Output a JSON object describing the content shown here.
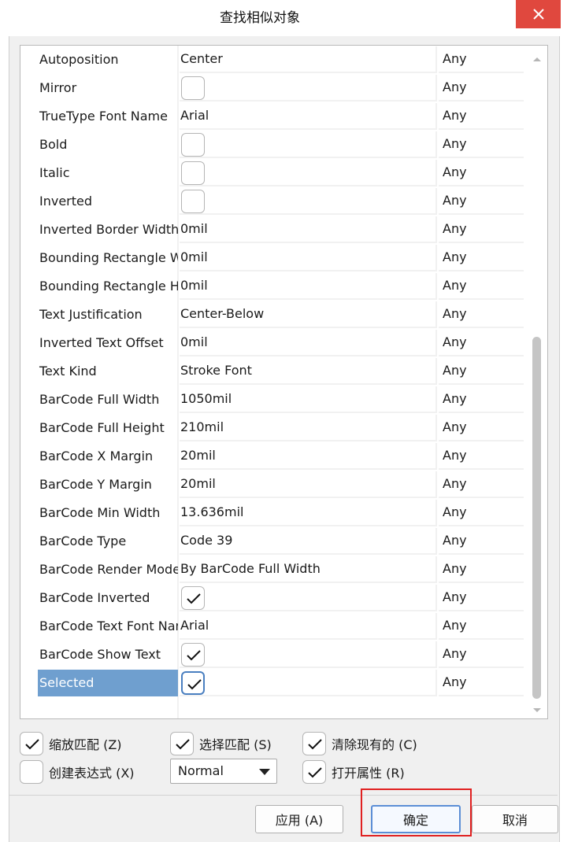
{
  "window": {
    "title": "查找相似对象",
    "close_glyph": "✕"
  },
  "rows": [
    {
      "name": "Autoposition",
      "type": "text",
      "value": "Center",
      "match": "Any"
    },
    {
      "name": "Mirror",
      "type": "check",
      "checked": false,
      "match": "Any"
    },
    {
      "name": "TrueType Font Name",
      "type": "text",
      "value": "Arial",
      "match": "Any"
    },
    {
      "name": "Bold",
      "type": "check",
      "checked": false,
      "match": "Any"
    },
    {
      "name": "Italic",
      "type": "check",
      "checked": false,
      "match": "Any"
    },
    {
      "name": "Inverted",
      "type": "check",
      "checked": false,
      "match": "Any"
    },
    {
      "name": "Inverted Border Width",
      "type": "text",
      "value": "0mil",
      "match": "Any"
    },
    {
      "name": "Bounding Rectangle Width",
      "type": "text",
      "value": "0mil",
      "match": "Any"
    },
    {
      "name": "Bounding Rectangle Height",
      "type": "text",
      "value": "0mil",
      "match": "Any"
    },
    {
      "name": "Text Justification",
      "type": "text",
      "value": "Center-Below",
      "match": "Any"
    },
    {
      "name": "Inverted Text Offset",
      "type": "text",
      "value": "0mil",
      "match": "Any"
    },
    {
      "name": "Text Kind",
      "type": "text",
      "value": "Stroke Font",
      "match": "Any"
    },
    {
      "name": "BarCode Full Width",
      "type": "text",
      "value": "1050mil",
      "match": "Any"
    },
    {
      "name": "BarCode Full Height",
      "type": "text",
      "value": "210mil",
      "match": "Any"
    },
    {
      "name": "BarCode X Margin",
      "type": "text",
      "value": "20mil",
      "match": "Any"
    },
    {
      "name": "BarCode Y Margin",
      "type": "text",
      "value": "20mil",
      "match": "Any"
    },
    {
      "name": "BarCode Min Width",
      "type": "text",
      "value": "13.636mil",
      "match": "Any"
    },
    {
      "name": "BarCode Type",
      "type": "text",
      "value": "Code 39",
      "match": "Any"
    },
    {
      "name": "BarCode Render Mode",
      "type": "text",
      "value": "By BarCode Full Width",
      "match": "Any"
    },
    {
      "name": "BarCode Inverted",
      "type": "check",
      "checked": true,
      "match": "Any"
    },
    {
      "name": "BarCode Text Font Name",
      "type": "text",
      "value": "Arial",
      "match": "Any"
    },
    {
      "name": "BarCode Show Text",
      "type": "check",
      "checked": true,
      "match": "Any"
    },
    {
      "name": "Selected",
      "type": "check",
      "checked": true,
      "match": "Any",
      "selected": true
    }
  ],
  "options": {
    "zoom_match": {
      "label": "缩放匹配 (Z)",
      "checked": true
    },
    "select_match": {
      "label": "选择匹配 (S)",
      "checked": true
    },
    "clear_existing": {
      "label": "清除现有的 (C)",
      "checked": true
    },
    "create_expression": {
      "label": "创建表达式 (X)",
      "checked": false
    },
    "open_inspector": {
      "label": "打开属性 (R)",
      "checked": true
    },
    "mode_select": {
      "value": "Normal"
    }
  },
  "buttons": {
    "apply": "应用 (A)",
    "ok": "确定",
    "cancel": "取消"
  },
  "colors": {
    "selection": "#6f9fcf",
    "close": "#e0483e",
    "highlight_box": "#e02020"
  }
}
